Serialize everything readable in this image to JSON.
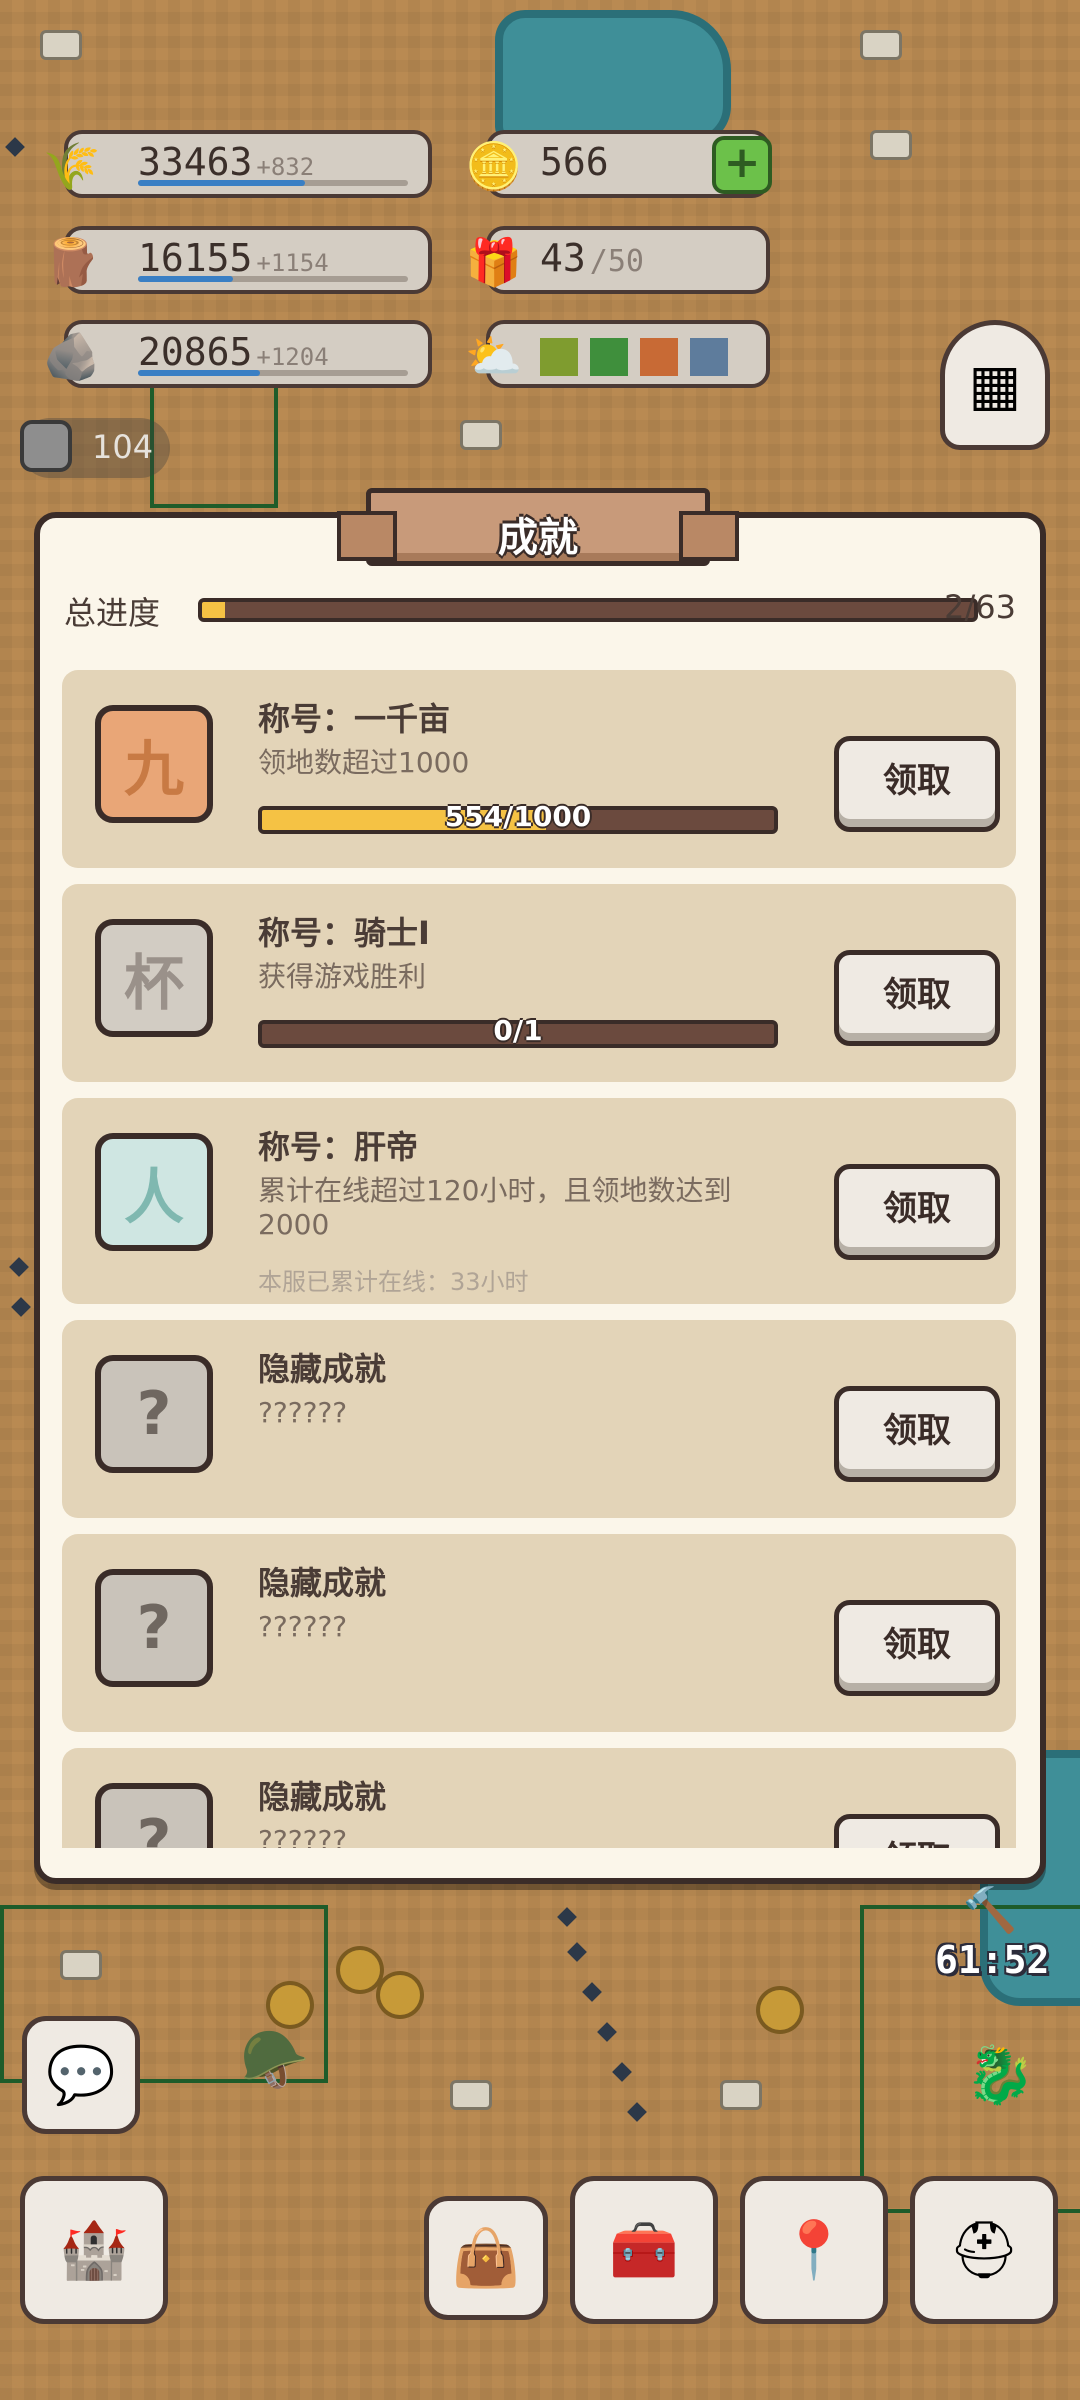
{
  "resources": {
    "food": {
      "value": "33463",
      "inc": "+832",
      "fill": 0.62
    },
    "wood": {
      "value": "16155",
      "inc": "+1154",
      "fill": 0.35
    },
    "stone": {
      "value": "20865",
      "inc": "+1204",
      "fill": 0.45
    },
    "coins": {
      "value": "566"
    },
    "gifts": {
      "value": "43",
      "max": "/50"
    },
    "weather_colors": [
      "#7f9c2f",
      "#3f8f3c",
      "#c86a35",
      "#5e7c9c"
    ],
    "ore": {
      "value": "104"
    }
  },
  "dialog": {
    "title": "成就",
    "overall_label": "总进度",
    "overall_count": "2/63",
    "overall_fraction": 0.03,
    "claim_label": "领取",
    "achievements": [
      {
        "name": "称号：一千亩",
        "desc": "领地数超过1000",
        "progress_text": "554/1000",
        "progress": 0.554,
        "badge": "九"
      },
      {
        "name": "称号：骑士I",
        "desc": "获得游戏胜利",
        "progress_text": "0/1",
        "progress": 0.0,
        "badge": "杯"
      },
      {
        "name": "称号：肝帝",
        "desc": "累计在线超过120小时，且领地数达到2000",
        "extra": "本服已累计在线：33小时",
        "badge": "人"
      },
      {
        "name": "隐藏成就",
        "desc": "??????",
        "badge": "?"
      },
      {
        "name": "隐藏成就",
        "desc": "??????",
        "badge": "?"
      },
      {
        "name": "隐藏成就",
        "desc": "??????",
        "badge": "?"
      }
    ]
  },
  "hud": {
    "timer": "61:52"
  },
  "icons": {
    "food": "wheat-icon",
    "wood": "log-icon",
    "stone": "stone-icon",
    "coins": "gold-coin-icon",
    "gifts": "gift-box-icon",
    "weather": "weather-icon",
    "menu": "grid-menu-icon",
    "chat": "chat-bubble-icon",
    "castle": "castle-icon",
    "bag": "bag-icon",
    "chest": "treasure-chest-icon",
    "map": "map-pin-icon",
    "helmet": "knight-helmet-icon",
    "dragon": "dragon-icon"
  }
}
